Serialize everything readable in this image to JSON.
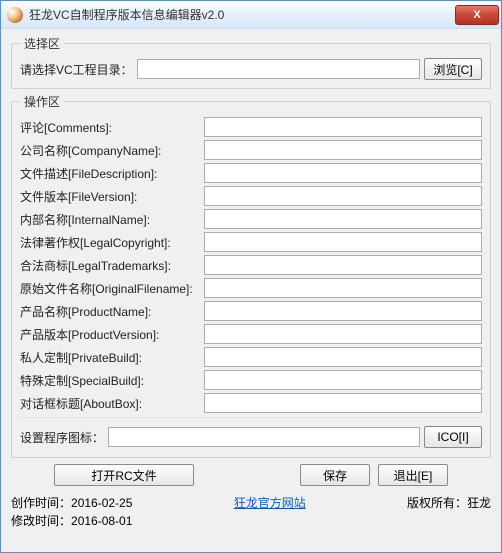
{
  "title": "狂龙VC自制程序版本信息编辑器v2.0",
  "close_glyph": "X",
  "select_section": {
    "legend": "选择区",
    "prompt": "请选择VC工程目录：",
    "path": "",
    "browse_btn": "浏览[C]"
  },
  "ops_section": {
    "legend": "操作区",
    "fields": [
      {
        "label": "评论[Comments]:",
        "value": "",
        "name": "comments"
      },
      {
        "label": "公司名称[CompanyName]:",
        "value": "",
        "name": "company-name"
      },
      {
        "label": "文件描述[FileDescription]:",
        "value": "",
        "name": "file-description"
      },
      {
        "label": "文件版本[FileVersion]:",
        "value": "",
        "name": "file-version"
      },
      {
        "label": "内部名称[InternalName]:",
        "value": "",
        "name": "internal-name"
      },
      {
        "label": "法律著作权[LegalCopyright]:",
        "value": "",
        "name": "legal-copyright"
      },
      {
        "label": "合法商标[LegalTrademarks]:",
        "value": "",
        "name": "legal-trademarks"
      },
      {
        "label": "原始文件名称[OriginalFilename]:",
        "value": "",
        "name": "original-filename"
      },
      {
        "label": "产品名称[ProductName]:",
        "value": "",
        "name": "product-name"
      },
      {
        "label": "产品版本[ProductVersion]:",
        "value": "",
        "name": "product-version"
      },
      {
        "label": "私人定制[PrivateBuild]:",
        "value": "",
        "name": "private-build"
      },
      {
        "label": "特殊定制[SpecialBuild]:",
        "value": "",
        "name": "special-build"
      },
      {
        "label": "对话框标题[AboutBox]:",
        "value": "",
        "name": "about-box"
      }
    ],
    "icon_label": "设置程序图标：",
    "icon_path": "",
    "ico_btn": "ICO[I]"
  },
  "buttons": {
    "open_rc": "打开RC文件",
    "save": "保存",
    "exit": "退出[E]"
  },
  "footer": {
    "created_label": "创作时间：",
    "created_value": "2016-02-25",
    "modified_label": "修改时间：",
    "modified_value": "2016-08-01",
    "link_text": "狂龙官方网站",
    "copyright": "版权所有：狂龙"
  }
}
